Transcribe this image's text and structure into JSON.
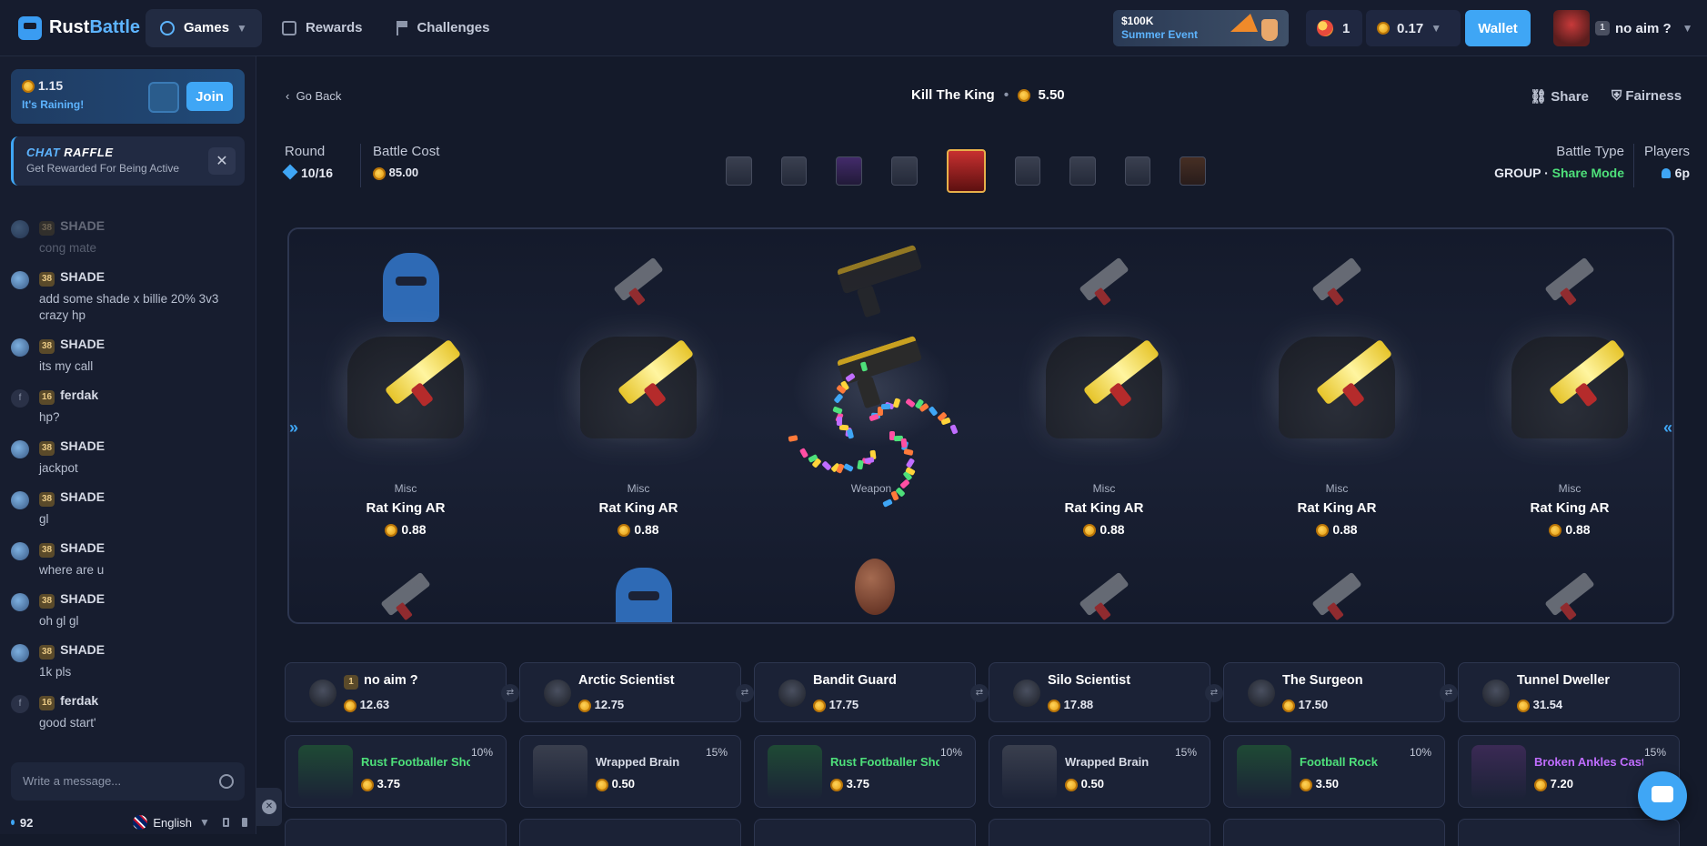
{
  "brand": {
    "name_a": "Rust",
    "name_b": "Battle"
  },
  "nav": {
    "games": "Games",
    "rewards": "Rewards",
    "challenges": "Challenges"
  },
  "event": {
    "amount": "$100K",
    "name": "Summer Event"
  },
  "header": {
    "balls": "1",
    "balance": "0.17",
    "wallet": "Wallet",
    "username": "no aim ?",
    "user_level": "1"
  },
  "rain": {
    "amount": "1.15",
    "label": "It's Raining!",
    "join": "Join"
  },
  "raffle": {
    "title_a": "CHAT",
    "title_b": "RAFFLE",
    "subtitle": "Get Rewarded For Being Active"
  },
  "chat": [
    {
      "level": "38",
      "name": "SHADE",
      "text": "cong mate",
      "faded": true
    },
    {
      "level": "38",
      "name": "SHADE",
      "text": "add some shade x billie 20% 3v3 crazy hp"
    },
    {
      "level": "38",
      "name": "SHADE",
      "text": "its my call"
    },
    {
      "level": "16",
      "name": "ferdak",
      "text": "hp?",
      "avatar_letter": "f"
    },
    {
      "level": "38",
      "name": "SHADE",
      "text": "jackpot"
    },
    {
      "level": "38",
      "name": "SHADE",
      "text": "gl"
    },
    {
      "level": "38",
      "name": "SHADE",
      "text": "where are u"
    },
    {
      "level": "38",
      "name": "SHADE",
      "text": "oh gl gl"
    },
    {
      "level": "38",
      "name": "SHADE",
      "text": "1k pls"
    },
    {
      "level": "16",
      "name": "ferdak",
      "text": "good start'",
      "avatar_letter": "f"
    }
  ],
  "chat_input": {
    "placeholder": "Write a message..."
  },
  "footer": {
    "online": "92",
    "language": "English"
  },
  "battle": {
    "go_back": "Go Back",
    "title": "Kill The King",
    "title_value": "5.50",
    "share": "Share",
    "fairness": "Fairness",
    "round_label": "Round",
    "round_value": "10/16",
    "cost_label": "Battle Cost",
    "cost_value": "85.00",
    "type_label": "Battle Type",
    "type_group": "GROUP",
    "type_dot": "·",
    "type_mode": "Share Mode",
    "players_label": "Players",
    "players_value": "6p"
  },
  "reel": [
    {
      "type": "Misc",
      "name": "Rat King AR",
      "price": "0.88"
    },
    {
      "type": "Misc",
      "name": "Rat King AR",
      "price": "0.88"
    },
    {
      "type": "Weapon",
      "name": "",
      "price": ""
    },
    {
      "type": "Misc",
      "name": "Rat King AR",
      "price": "0.88"
    },
    {
      "type": "Misc",
      "name": "Rat King AR",
      "price": "0.88"
    },
    {
      "type": "Misc",
      "name": "Rat King AR",
      "price": "0.88"
    }
  ],
  "players": [
    {
      "name": "no aim ?",
      "level": "1",
      "value": "12.63"
    },
    {
      "name": "Arctic Scientist",
      "value": "12.75"
    },
    {
      "name": "Bandit Guard",
      "value": "17.75"
    },
    {
      "name": "Silo Scientist",
      "value": "17.88"
    },
    {
      "name": "The Surgeon",
      "value": "17.50"
    },
    {
      "name": "Tunnel Dweller",
      "value": "31.54"
    }
  ],
  "loot": [
    {
      "name": "Rust Footballer Shorts",
      "value": "3.75",
      "pct": "10%",
      "rarity": "green"
    },
    {
      "name": "Wrapped Brain",
      "value": "0.50",
      "pct": "15%",
      "rarity": "normal"
    },
    {
      "name": "Rust Footballer Shorts",
      "value": "3.75",
      "pct": "10%",
      "rarity": "green"
    },
    {
      "name": "Wrapped Brain",
      "value": "0.50",
      "pct": "15%",
      "rarity": "normal"
    },
    {
      "name": "Football Rock",
      "value": "3.50",
      "pct": "10%",
      "rarity": "green"
    },
    {
      "name": "Broken Ankles Cast",
      "value": "7.20",
      "pct": "15%",
      "rarity": "purple"
    }
  ],
  "colors": {
    "accent": "#3fa6f5",
    "green": "#4ee07a",
    "purple": "#c06dff",
    "bg": "#141a2a"
  }
}
